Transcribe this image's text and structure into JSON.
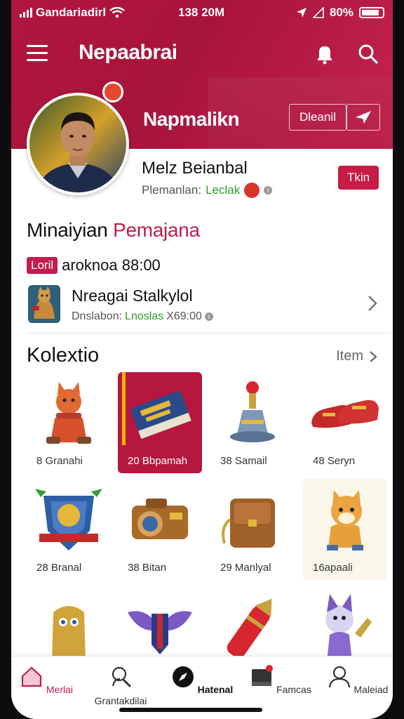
{
  "status_bar": {
    "carrier": "Gandariadirl",
    "time": "138 20M",
    "battery": "80%"
  },
  "app_bar": {
    "title": "Nepaabrai"
  },
  "profile": {
    "hero_name": "Napmalikn",
    "edit_label": "Dleanil",
    "player_name": "Melz Beianbal",
    "meta_label": "Plemanlan:",
    "meta_value": "Leclak",
    "tag_label": "Tkin"
  },
  "market": {
    "heading_plain": "Minaiyian",
    "heading_accent": "Pemajana",
    "balance_tag": "Loril",
    "balance_value": "aroknoa 88:00",
    "listing": {
      "title": "Nreagai Stalkylol",
      "sub_label": "Dnslabon:",
      "sub_value": "Lnoslas",
      "sub_price": "X69:00"
    }
  },
  "collection": {
    "title": "Kolextio",
    "view_all": "Item",
    "items": [
      {
        "label": "8 Granahi",
        "icon": "fox-figure-icon"
      },
      {
        "label": "20 Bbpamah",
        "icon": "book-icon"
      },
      {
        "label": "38 Samail",
        "icon": "bell-icon"
      },
      {
        "label": "48 Seryn",
        "icon": "shoes-icon"
      },
      {
        "label": "28 Branal",
        "icon": "shield-crest-icon"
      },
      {
        "label": "38 Bitan",
        "icon": "camera-icon"
      },
      {
        "label": "29 Manlyal",
        "icon": "bag-icon"
      },
      {
        "label": "16apaali",
        "icon": "cat-figure-icon"
      },
      {
        "label": "",
        "icon": "golem-figure-icon"
      },
      {
        "label": "",
        "icon": "wing-badge-icon"
      },
      {
        "label": "",
        "icon": "rocket-icon"
      },
      {
        "label": "",
        "icon": "wolf-figure-icon"
      }
    ]
  },
  "bottom_nav": [
    {
      "label": "Merlai",
      "icon": "home-icon"
    },
    {
      "label": "Grantakdilai",
      "icon": "search-person-icon"
    },
    {
      "label": "Hatenal",
      "icon": "compass-icon"
    },
    {
      "label": "Famcas",
      "icon": "inbox-icon"
    },
    {
      "label": "Maleiad",
      "icon": "profile-icon"
    }
  ],
  "colors": {
    "brand": "#b0173f",
    "accent": "#c01d4c",
    "green": "#2e9b2e"
  }
}
